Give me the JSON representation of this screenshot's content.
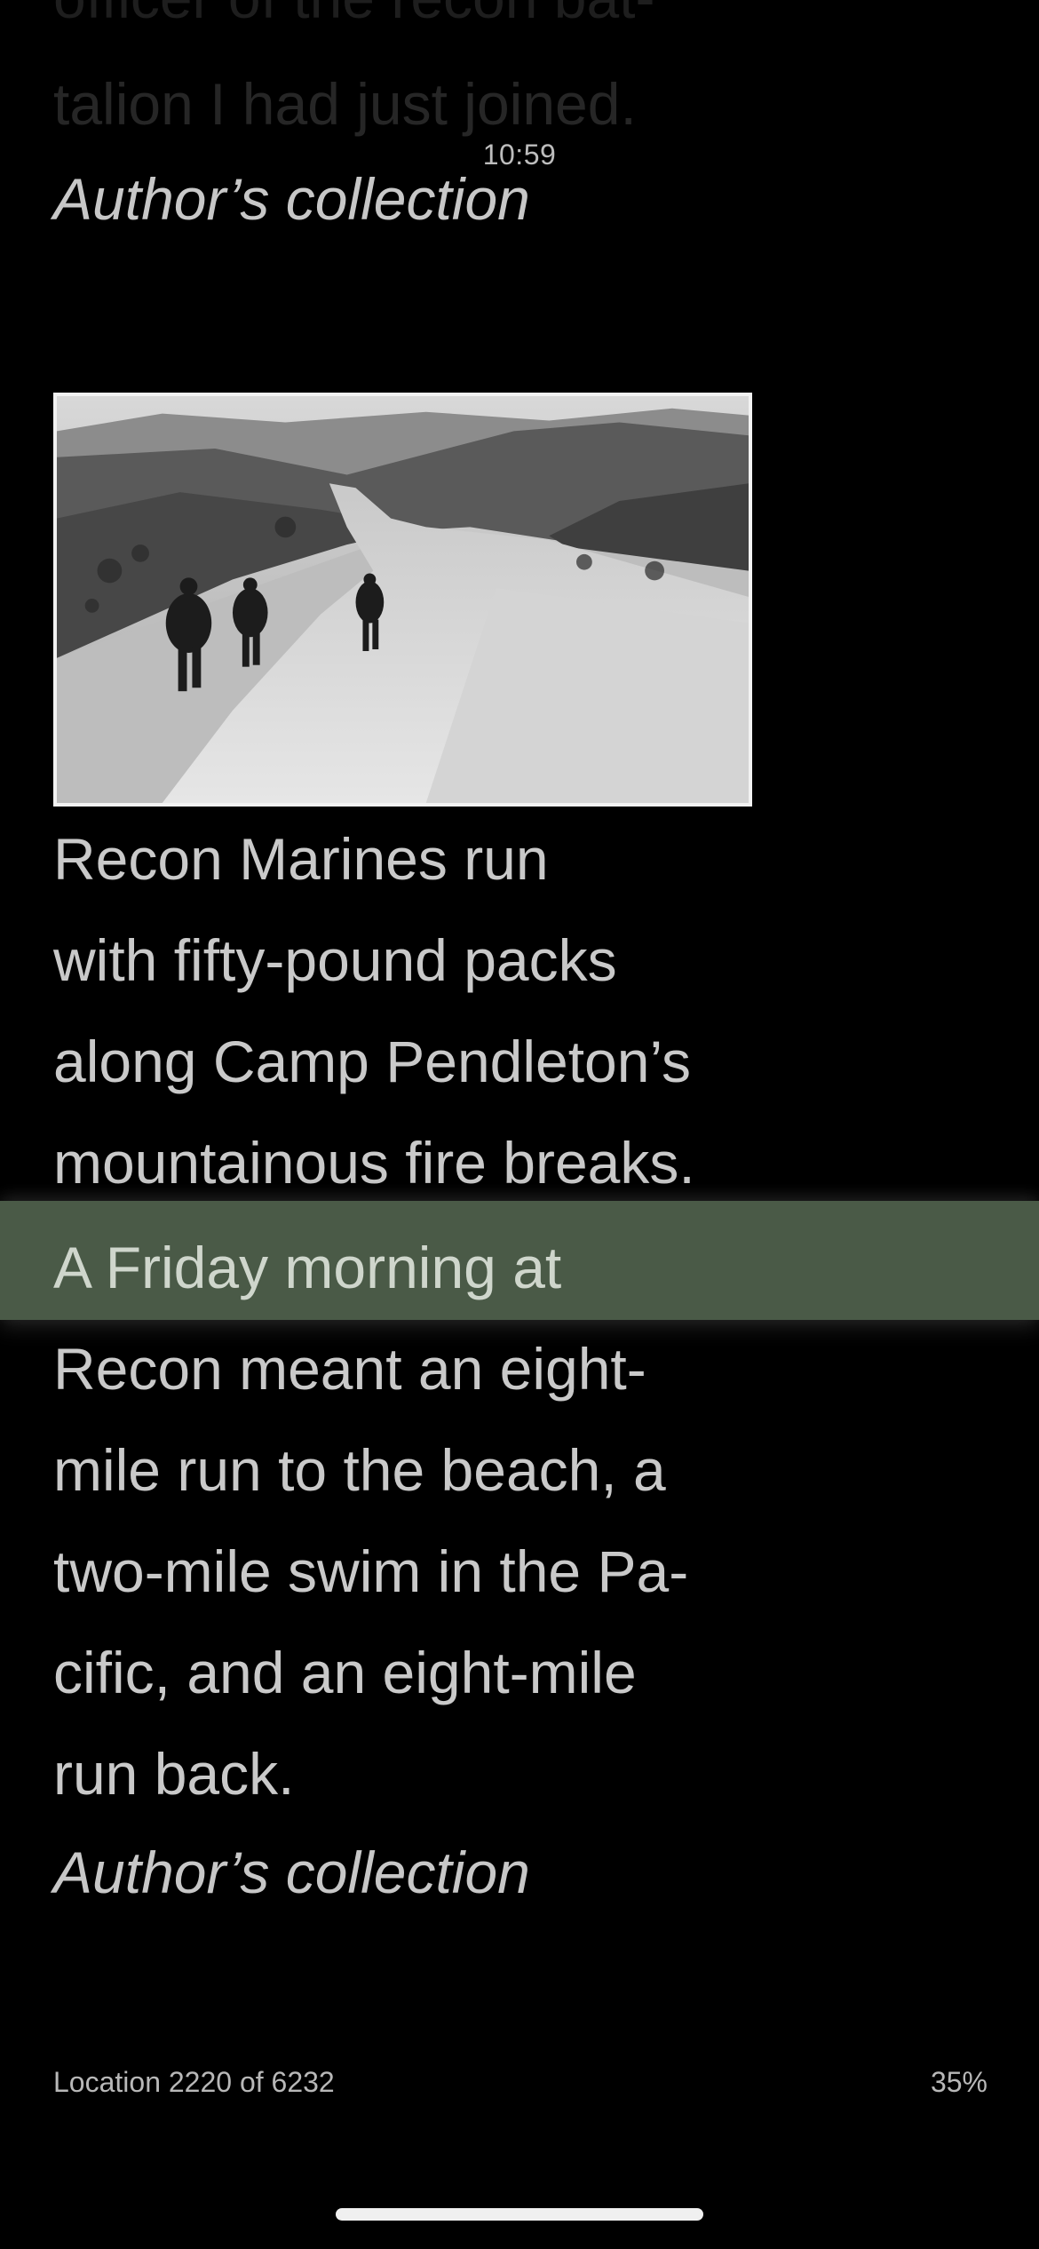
{
  "status_bar": {
    "time": "10:59"
  },
  "book": {
    "previous_lines": [
      "officer of the recon bat-",
      "talion I had just joined."
    ],
    "caption_top": "Author’s collection",
    "photo_icon": "photo-recon-marines-running",
    "caption_lines": [
      "Recon Marines run",
      "with fifty-pound packs",
      "along Camp Pendleton’s",
      "mountainous fire breaks."
    ],
    "highlighted_line": "A Friday morning at",
    "body_lines": [
      "Recon meant an eight-",
      "mile run to the beach, a",
      "two-mile swim in the Pa-",
      "cific, and an eight-mile",
      "run back."
    ],
    "caption_bottom": "Author’s collection"
  },
  "footer": {
    "location": "Location 2220 of 6232",
    "percent": "35%"
  },
  "colors": {
    "background": "#000000",
    "highlight": "#4a5a47",
    "text": "#c9c9c9"
  }
}
